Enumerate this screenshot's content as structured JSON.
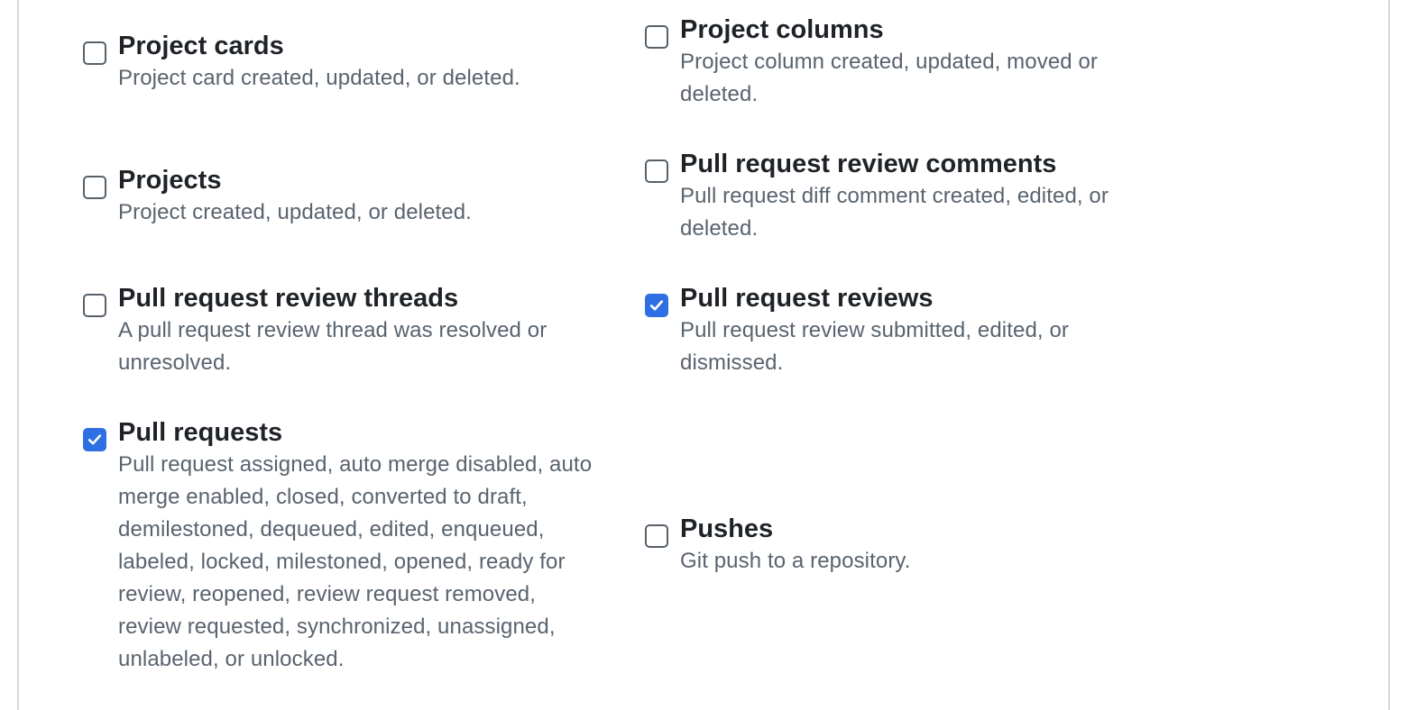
{
  "events": [
    {
      "title": "Project cards",
      "checked": false,
      "description_lines": [
        "Project card created, updated, or deleted."
      ]
    },
    {
      "title": "Project columns",
      "checked": false,
      "description_lines": [
        "Project column created, updated, moved or",
        "deleted."
      ]
    },
    {
      "title": "Projects",
      "checked": false,
      "description_lines": [
        "Project created, updated, or deleted."
      ]
    },
    {
      "title": "Pull request review comments",
      "checked": false,
      "description_lines": [
        "Pull request diff comment created, edited, or",
        "deleted."
      ]
    },
    {
      "title": "Pull request review threads",
      "checked": false,
      "description_lines": [
        "A pull request review thread was resolved or",
        "unresolved."
      ]
    },
    {
      "title": "Pull request reviews",
      "checked": true,
      "description_lines": [
        "Pull request review submitted, edited, or",
        "dismissed."
      ]
    },
    {
      "title": "Pull requests",
      "checked": true,
      "description_lines": [
        "Pull request assigned, auto merge disabled, auto",
        "merge enabled, closed, converted to draft,",
        "demilestoned, dequeued, edited, enqueued,",
        "labeled, locked, milestoned, opened, ready for",
        "review, reopened, review request removed,",
        "review requested, synchronized, unassigned,",
        "unlabeled, or unlocked."
      ]
    },
    {
      "title": "Pushes",
      "checked": false,
      "description_lines": [
        "Git push to a repository."
      ]
    }
  ],
  "colors": {
    "checkbox_checked": "#2f6fe4",
    "title_text": "#1f2328",
    "description_text": "#59636e"
  },
  "icons": {
    "checked": "checkmark-icon"
  }
}
